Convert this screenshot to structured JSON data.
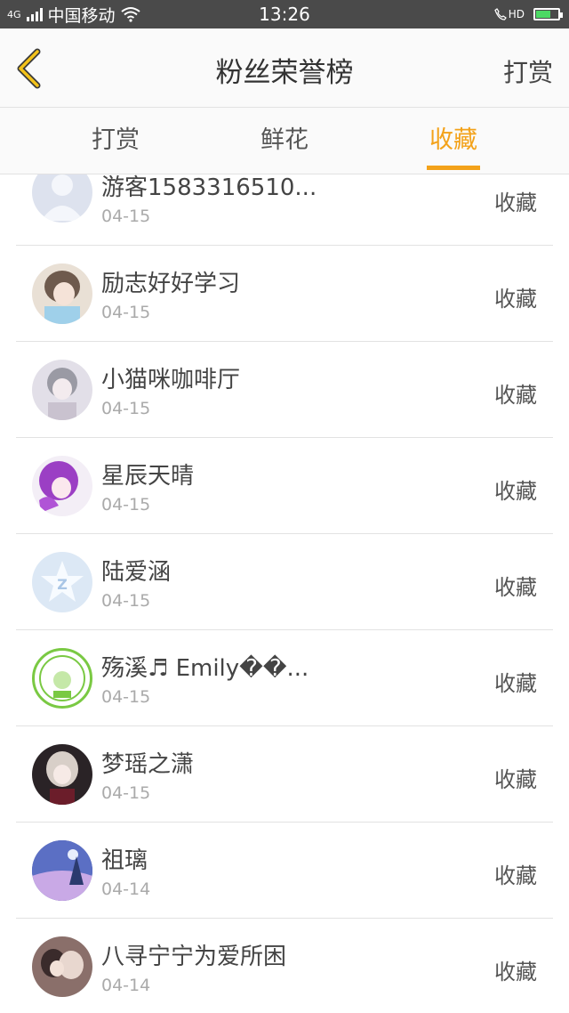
{
  "status_bar": {
    "carrier": "中国移动",
    "time": "13:26",
    "network": "4G",
    "call_indicator": "HD"
  },
  "nav": {
    "title": "粉丝荣誉榜",
    "action": "打赏",
    "back_icon": "back-chevron-icon"
  },
  "tabs": [
    {
      "label": "打赏",
      "active": false
    },
    {
      "label": "鲜花",
      "active": false
    },
    {
      "label": "收藏",
      "active": true
    }
  ],
  "colors": {
    "accent": "#f3a21a",
    "status_bar_bg": "#4a4a4a",
    "divider": "#e2e2e2"
  },
  "fans": [
    {
      "name": "游客1583316510...",
      "date": "04-15",
      "action": "收藏",
      "avatar": "default-user-avatar"
    },
    {
      "name": "励志好好学习",
      "date": "04-15",
      "action": "收藏",
      "avatar": "anime-girl-avatar"
    },
    {
      "name": "小猫咪咖啡厅",
      "date": "04-15",
      "action": "收藏",
      "avatar": "anime-boy-avatar"
    },
    {
      "name": "星辰天晴",
      "date": "04-15",
      "action": "收藏",
      "avatar": "purple-hair-anime-avatar"
    },
    {
      "name": "陆爱涵",
      "date": "04-15",
      "action": "收藏",
      "avatar": "star-logo-avatar"
    },
    {
      "name": "殇溪♬ Emily��...",
      "date": "04-15",
      "action": "收藏",
      "avatar": "green-badge-avatar"
    },
    {
      "name": "梦瑶之潇",
      "date": "04-15",
      "action": "收藏",
      "avatar": "dark-anime-girl-avatar"
    },
    {
      "name": "祖璃",
      "date": "04-14",
      "action": "收藏",
      "avatar": "night-landscape-avatar"
    },
    {
      "name": "八寻宁宁为爱所困",
      "date": "04-14",
      "action": "收藏",
      "avatar": "anime-couple-avatar"
    }
  ]
}
